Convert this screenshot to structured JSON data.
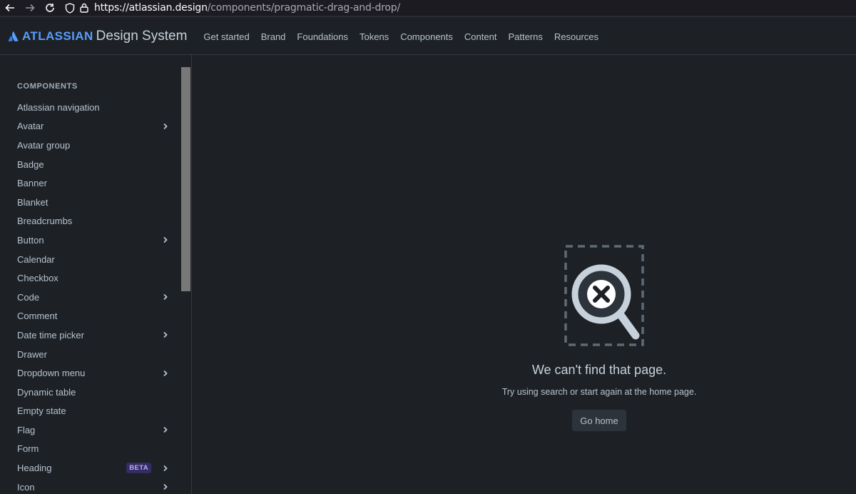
{
  "browser": {
    "url_host": "https://atlassian.design",
    "url_path": "/components/pragmatic-drag-and-drop/"
  },
  "brand": {
    "name": "ATLASSIAN",
    "subtitle": "Design System",
    "accent_color": "#579dff"
  },
  "nav": {
    "links": [
      "Get started",
      "Brand",
      "Foundations",
      "Tokens",
      "Components",
      "Content",
      "Patterns",
      "Resources"
    ]
  },
  "sidebar": {
    "heading": "COMPONENTS",
    "items": [
      {
        "label": "Atlassian navigation",
        "expandable": false
      },
      {
        "label": "Avatar",
        "expandable": true
      },
      {
        "label": "Avatar group",
        "expandable": false
      },
      {
        "label": "Badge",
        "expandable": false
      },
      {
        "label": "Banner",
        "expandable": false
      },
      {
        "label": "Blanket",
        "expandable": false
      },
      {
        "label": "Breadcrumbs",
        "expandable": false
      },
      {
        "label": "Button",
        "expandable": true
      },
      {
        "label": "Calendar",
        "expandable": false
      },
      {
        "label": "Checkbox",
        "expandable": false
      },
      {
        "label": "Code",
        "expandable": true
      },
      {
        "label": "Comment",
        "expandable": false
      },
      {
        "label": "Date time picker",
        "expandable": true
      },
      {
        "label": "Drawer",
        "expandable": false
      },
      {
        "label": "Dropdown menu",
        "expandable": true
      },
      {
        "label": "Dynamic table",
        "expandable": false
      },
      {
        "label": "Empty state",
        "expandable": false
      },
      {
        "label": "Flag",
        "expandable": true
      },
      {
        "label": "Form",
        "expandable": false
      },
      {
        "label": "Heading",
        "expandable": true,
        "badge": "BETA"
      },
      {
        "label": "Icon",
        "expandable": true
      }
    ]
  },
  "empty_state": {
    "title": "We can't find that page.",
    "description": "Try using search or start again at the home page.",
    "button_label": "Go home",
    "icon": "magnifier-x-icon"
  }
}
